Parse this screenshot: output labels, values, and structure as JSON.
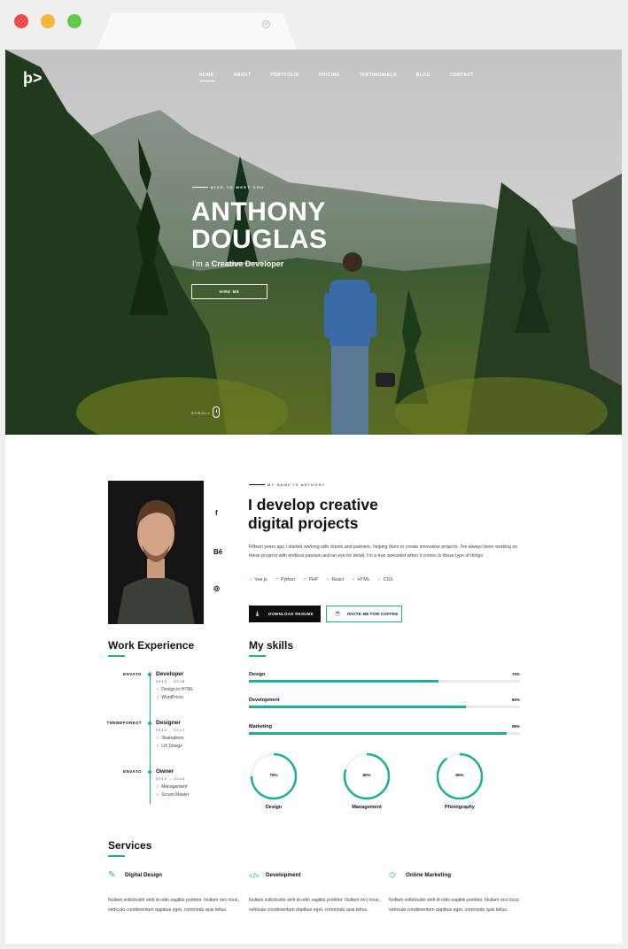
{
  "browser": {
    "tab_close": "×"
  },
  "hero": {
    "logo": "ϸ>",
    "nav": [
      "HOME",
      "ABOUT",
      "PORTFOLIO",
      "PRICING",
      "TESTIMONIALS",
      "BLOG",
      "CONTACT"
    ],
    "intro": "NICE TO MEET YOU",
    "first_name": "ANTHONY",
    "last_name": "DOUGLAS",
    "role_prefix": "I'm a",
    "role": "Creative Developer",
    "hire_button": "HIRE ME",
    "scroll_label": "SCROLL"
  },
  "about": {
    "social": {
      "facebook": "f",
      "behance": "Bē",
      "instagram": "◎"
    },
    "intro": "MY NAME IS ANTHONY",
    "title_line1": "I develop creative",
    "title_line2": "digital projects",
    "text": "Fifteen years ago I started working with clients and partners, helping them to create innovative projects. I've always been working on these projects with endless passion and an eye for detail. I'm a true specialist when it comes to these type of things:",
    "tags": [
      "Vue.js",
      "Python",
      "PHP",
      "React",
      "HTML",
      "CSS"
    ],
    "download_button": "DOWNLOAD RESUME",
    "coffee_button": "INVITE ME FOR COFFEE"
  },
  "experience": {
    "title": "Work Experience",
    "items": [
      {
        "company": "ENVATO",
        "role": "Developer",
        "years": "2010 - 2018",
        "points": [
          "Design to HTML",
          "WordPress"
        ]
      },
      {
        "company": "THEMEFOREST",
        "role": "Designer",
        "years": "2014 - 2017",
        "points": [
          "Illustrations",
          "UX Design"
        ]
      },
      {
        "company": "ENVATO",
        "role": "Owner",
        "years": "2010 - 2014",
        "points": [
          "Management",
          "Scrum Master"
        ]
      }
    ]
  },
  "skills": {
    "title": "My skills",
    "bars": [
      {
        "label": "Design",
        "pct_label": "70%",
        "value": 0.7
      },
      {
        "label": "Development",
        "pct_label": "80%",
        "value": 0.8
      },
      {
        "label": "Marketing",
        "pct_label": "95%",
        "value": 0.95
      }
    ],
    "circles": [
      {
        "label": "Design",
        "pct_label": "75%",
        "value": 0.75
      },
      {
        "label": "Management",
        "pct_label": "80%",
        "value": 0.8
      },
      {
        "label": "Photography",
        "pct_label": "90%",
        "value": 0.9
      }
    ],
    "accent": "#1fae95"
  },
  "services": {
    "title": "Services",
    "items": [
      {
        "title": "Digital Design",
        "icon": "pen-icon",
        "text": "Nullam sollicitudin velit id odio sagittis porttitor. Nullam orci risus, vehicula condimentum dapibus eget, commodo quis tellus."
      },
      {
        "title": "Development",
        "icon": "code-icon",
        "text": "Nullam sollicitudin velit id odio sagittis porttitor. Nullam orci risus, vehicula condimentum dapibus eget, commodo quis tellus."
      },
      {
        "title": "Online Marketing",
        "icon": "diamond-icon",
        "text": "Nullam sollicitudin velit id odio sagittis porttitor. Nullam orci risus, vehicula condimentum dapibus eget, commodo quis tellus."
      }
    ]
  }
}
